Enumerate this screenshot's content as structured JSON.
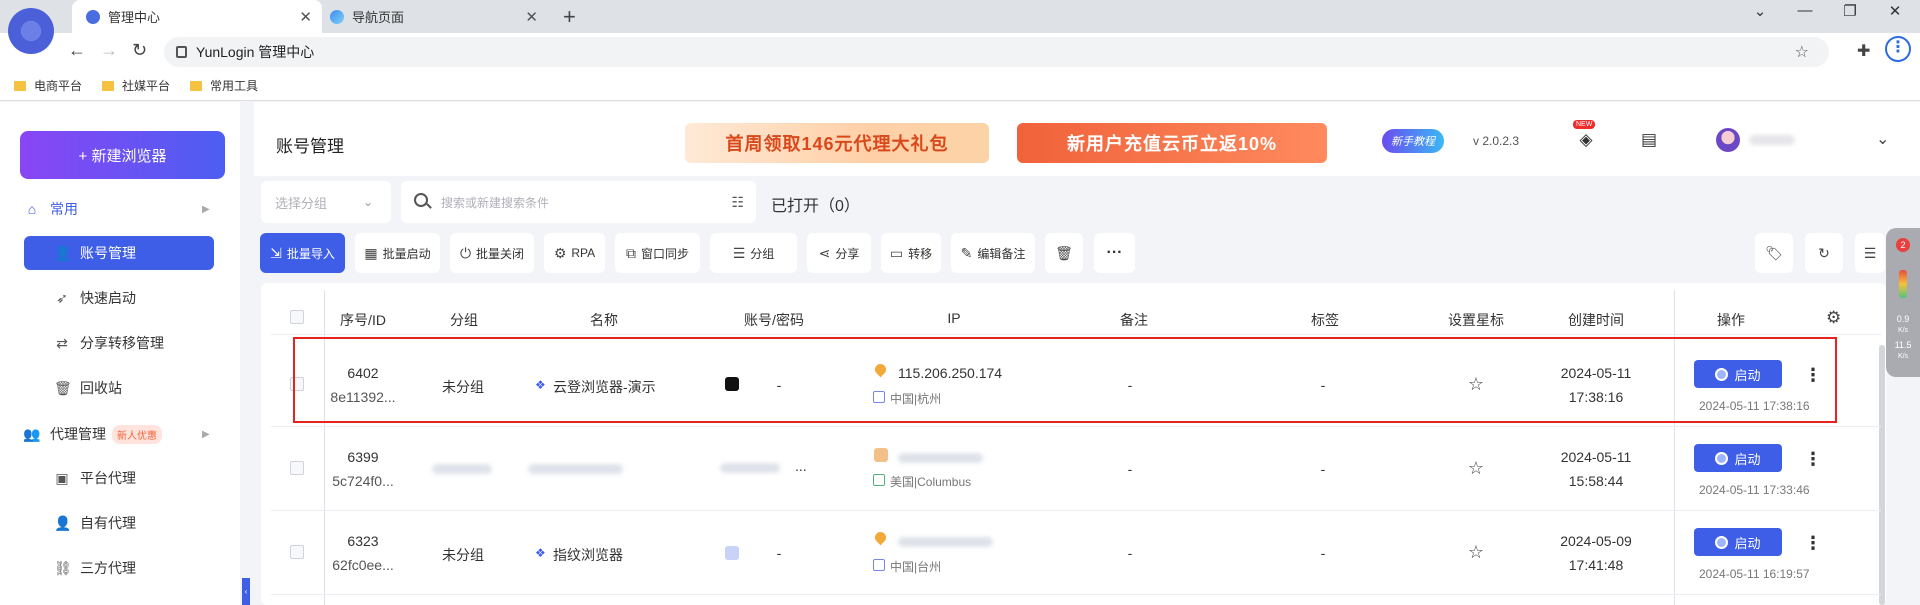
{
  "browser": {
    "tabs": [
      {
        "label": "管理中心",
        "active": true
      },
      {
        "label": "导航页面",
        "active": false
      }
    ],
    "address": "YunLogin 管理中心",
    "bookmarks": [
      "电商平台",
      "社媒平台",
      "常用工具"
    ]
  },
  "sidebar": {
    "new_browser": "+ 新建浏览器",
    "sections": [
      {
        "label": "常用",
        "icon": "home-icon"
      },
      {
        "label": "代理管理",
        "icon": "proxy-icon",
        "badge": "新人优惠"
      }
    ],
    "items": [
      {
        "label": "账号管理",
        "icon": "user-icon",
        "active": true
      },
      {
        "label": "快速启动",
        "icon": "rocket-icon"
      },
      {
        "label": "分享转移管理",
        "icon": "share-icon"
      },
      {
        "label": "回收站",
        "icon": "trash-icon"
      },
      {
        "label": "平台代理",
        "icon": "platform-icon"
      },
      {
        "label": "自有代理",
        "icon": "user-icon"
      },
      {
        "label": "三方代理",
        "icon": "network-icon"
      }
    ]
  },
  "header": {
    "title": "账号管理",
    "promo1": "首周领取146元代理大礼包",
    "promo2": "新用户充值云币立返10%",
    "tutorial": "新手教程",
    "version": "v 2.0.2.3",
    "new_tag": "NEW"
  },
  "filters": {
    "group_placeholder": "选择分组",
    "search_placeholder": "搜索或新建搜索条件",
    "opened_label": "已打开（0）"
  },
  "actions": [
    {
      "label": "批量导入",
      "icon": "import-icon",
      "primary": true
    },
    {
      "label": "批量启动",
      "icon": "launch-icon"
    },
    {
      "label": "批量关闭",
      "icon": "power-icon"
    },
    {
      "label": "RPA",
      "icon": "robot-icon"
    },
    {
      "label": "窗口同步",
      "icon": "sync-window-icon"
    },
    {
      "label": "分组",
      "icon": "group-icon"
    },
    {
      "label": "分享",
      "icon": "share-icon"
    },
    {
      "label": "转移",
      "icon": "transfer-icon"
    },
    {
      "label": "编辑备注",
      "icon": "edit-icon"
    },
    {
      "label": "",
      "icon": "trash-icon"
    },
    {
      "label": "···",
      "icon": "more-icon"
    }
  ],
  "rail": {
    "badge": "2",
    "speed1": "0.9",
    "unit1": "K/s",
    "speed2": "11.5",
    "unit2": "K/s"
  },
  "table": {
    "columns": [
      "序号/ID",
      "分组",
      "名称",
      "账号/密码",
      "IP",
      "备注",
      "标签",
      "设置星标",
      "创建时间",
      "操作"
    ],
    "launch_label": "启动",
    "rows": [
      {
        "seq": "6402",
        "id": "8e11392...",
        "group": "未分组",
        "name": "云登浏览器-演示",
        "account": "-",
        "ip": "115.206.250.174",
        "geo": "中国|杭州",
        "note": "-",
        "tag": "-",
        "created_date": "2024-05-11",
        "created_time": "17:38:16",
        "last_launch": "2024-05-11 17:38:16"
      },
      {
        "seq": "6399",
        "id": "5c724f0...",
        "group": "",
        "name": "",
        "account": "...",
        "ip": "",
        "geo": "美国|Columbus",
        "note": "-",
        "tag": "-",
        "created_date": "2024-05-11",
        "created_time": "15:58:44",
        "last_launch": "2024-05-11 17:33:46"
      },
      {
        "seq": "6323",
        "id": "62fc0ee...",
        "group": "未分组",
        "name": "指纹浏览器",
        "account": "-",
        "ip": "",
        "geo": "中国|台州",
        "note": "-",
        "tag": "-",
        "created_date": "2024-05-09",
        "created_time": "17:41:48",
        "last_launch": "2024-05-11 16:19:57"
      }
    ]
  }
}
